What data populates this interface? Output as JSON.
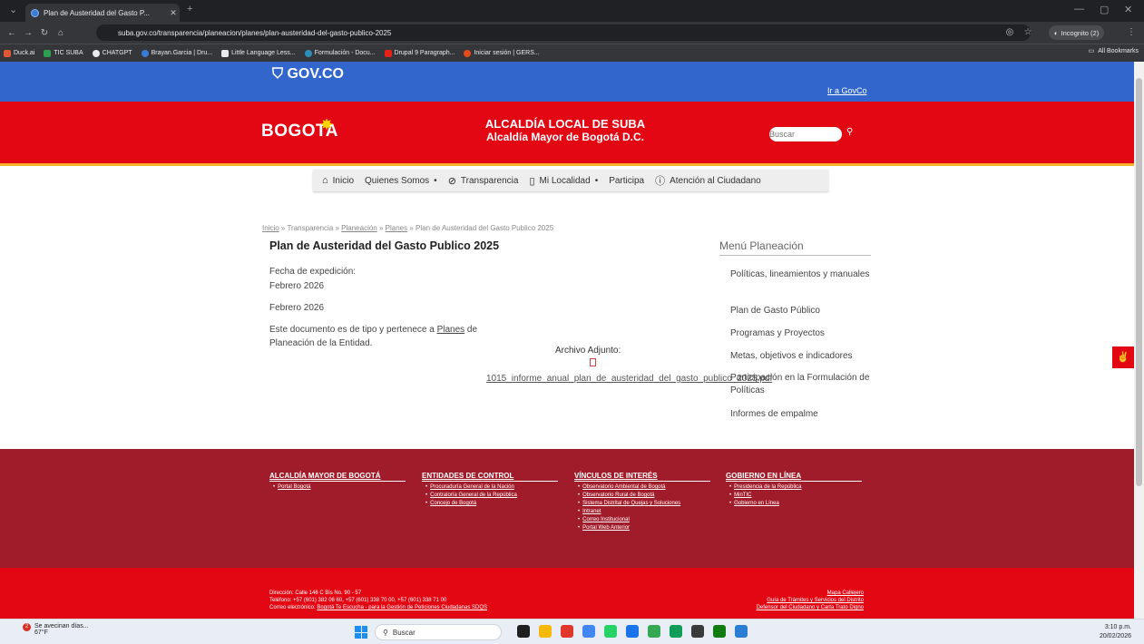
{
  "browser": {
    "tab_title": "Plan de Austeridad del Gasto P...",
    "tab_close": "✕",
    "new_tab": "+",
    "url": "suba.gov.co/transparencia/planeacion/planes/plan-austeridad-del-gasto-publico-2025",
    "incognito_label": "Incognito (2)",
    "bookmarks": [
      {
        "label": "Duck.ai",
        "color": "#de5833"
      },
      {
        "label": "TIC SUBA",
        "color": "#2e9e4f"
      },
      {
        "label": "CHATGPT",
        "color": "#e8eaed"
      },
      {
        "label": "Brayan.Garcia | Dru...",
        "color": "#3a7bd5"
      },
      {
        "label": "Little Language Less...",
        "color": "#e8eaed"
      },
      {
        "label": "Formulación - Docu...",
        "color": "#2c8ebb"
      },
      {
        "label": "Drupal 9 Paragraph...",
        "color": "#e62117"
      },
      {
        "label": "Iniciar sesión | GERS...",
        "color": "#e64a19"
      }
    ],
    "all_bookmarks": "All Bookmarks"
  },
  "gov": {
    "logo": "GOV.CO",
    "link": "Ir a GovCo"
  },
  "header": {
    "logo": "BOGOTA",
    "title1": "ALCALDÍA LOCAL DE SUBA",
    "title2": "Alcaldía Mayor de Bogotá D.C.",
    "search_placeholder": "Buscar"
  },
  "nav": {
    "items": [
      "Inicio",
      "Quienes Somos",
      "Transparencia",
      "Mi Localidad",
      "Participa",
      "Atención al Ciudadano"
    ]
  },
  "content": {
    "breadcrumb": {
      "inicio": "Inicio",
      "sep1": " » Transparencia » ",
      "planeacion": "Planeación",
      "sep2": " » ",
      "planes": "Planes",
      "rest": " » Plan de Austeridad del Gasto Publico 2025"
    },
    "title": "Plan de Austeridad del Gasto Publico 2025",
    "fecha_label": "Fecha de expedición:",
    "fecha_value": "Febrero 2026",
    "fecha_repeat": "Febrero 2026",
    "doc_text_1": "Este documento es de tipo y pertenece a ",
    "doc_link": "Planes",
    "doc_text_2": " de",
    "doc_text_3": "Planeación de la Entidad.",
    "attach_label": "Archivo Adjunto:",
    "attach_file": "1015_informe_anual_plan_de_austeridad_del_gasto_publico_2025.pdf"
  },
  "sidebar": {
    "title": "Menú Planeación",
    "items": [
      "Políticas, lineamientos y manuales",
      "Plan de Gasto Público",
      "Programas y Proyectos",
      "Metas, objetivos e indicadores",
      "Participación en la Formulación de Políticas",
      "Informes de empalme"
    ]
  },
  "footer": {
    "columns": [
      {
        "heading": "ALCALDÍA MAYOR DE BOGOTÁ",
        "links": [
          "Portal Bogotá"
        ]
      },
      {
        "heading": "ENTIDADES DE CONTROL",
        "links": [
          "Procuraduría General de la Nación",
          "Contraloría General de la República",
          "Concejo de Bogotá"
        ]
      },
      {
        "heading": "VÍNCULOS DE INTERÉS",
        "links": [
          "Observatorio Ambiental de Bogotá",
          "Observatorio Rural de Bogotá",
          "Sistema Distrital de Quejas y Soluciones",
          "Intranet",
          "Correo Institucional",
          "Portal Web Anterior"
        ]
      },
      {
        "heading": "GOBIERNO EN LÍNEA",
        "links": [
          "Presidencia de la República",
          "MinTIC",
          "Gobierno en Línea"
        ]
      }
    ],
    "address": "Dirección: Calle 146 C Bis No. 90 - 57",
    "phone": "Teléfono: +57 (601) 382 06 60, +57 (601) 338 70 00, +57 (601) 338 71 00",
    "email_prefix": "Correo electrónico: ",
    "email_link": "Bogotá Te Escucha - para la Gestión de Peticiones Ciudadanas SDQS",
    "right_links": [
      "Mapa Callejero",
      "Guía de Trámites y Servicios del Distrito",
      "Defensor del Ciudadano y Carta Trato Digno"
    ]
  },
  "taskbar": {
    "weather_title": "Se avecinan días...",
    "weather_temp": "67°F",
    "notification_count": "2",
    "search": "Buscar",
    "time": "3:10 p.m.",
    "date": "20/02/2026",
    "apps": [
      "#1f1f1f",
      "#f6b800",
      "#e0392b",
      "#4285f4",
      "#25d366",
      "#1a73e8",
      "#34a853",
      "#0f9d58",
      "#3a3a3a",
      "#107c10",
      "#2b7cd3"
    ]
  }
}
